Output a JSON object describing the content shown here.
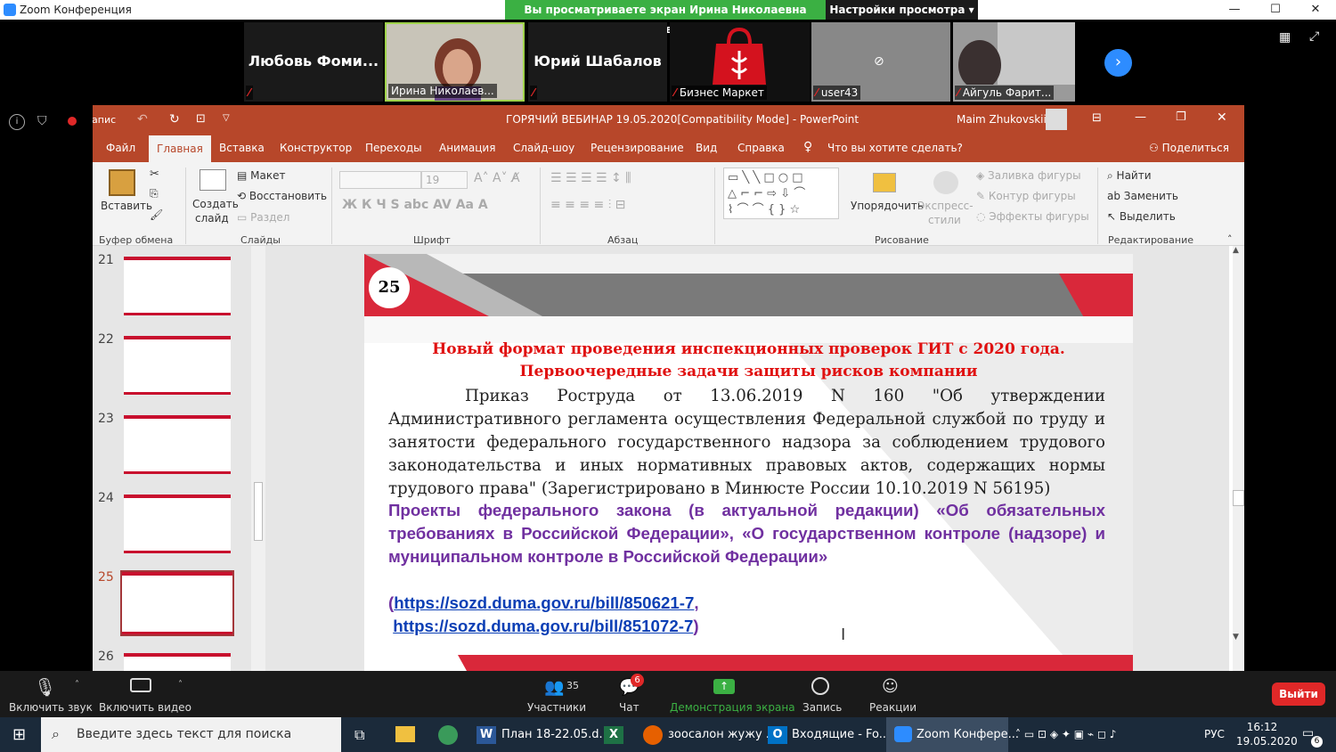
{
  "zoom": {
    "title": "Zoom Конференция",
    "banner": "Вы просматриваете экран Ирина Николаевна Жуковская",
    "view_settings": "Настройки просмотра ▾",
    "participants": [
      {
        "name": "Любовь Фоми...",
        "label": ""
      },
      {
        "name": "",
        "label": "Ирина Николаев..."
      },
      {
        "name": "Юрий Шабалов",
        "label": ""
      },
      {
        "name": "",
        "label": "Бизнес Маркет"
      },
      {
        "name": "",
        "label": "user43"
      },
      {
        "name": "",
        "label": "Айгуль Фарит..."
      }
    ],
    "recording_label": "Запис",
    "toolbar": {
      "mute": "Включить звук",
      "video": "Включить видео",
      "participants": "Участники",
      "participants_count": "35",
      "chat": "Чат",
      "chat_badge": "6",
      "share": "Демонстрация экрана",
      "record": "Запись",
      "reactions": "Реакции",
      "leave": "Выйти"
    }
  },
  "ppt": {
    "title": "ГОРЯЧИЙ ВЕБИНАР 19.05.2020[Compatibility Mode]  -  PowerPoint",
    "user": "Maim Zhukovskii",
    "tabs": [
      "Файл",
      "Главная",
      "Вставка",
      "Конструктор",
      "Переходы",
      "Анимация",
      "Слайд-шоу",
      "Рецензирование",
      "Вид",
      "Справка"
    ],
    "tell_me": "Что вы хотите сделать?",
    "share": "Поделиться",
    "ribbon": {
      "paste": "Вставить",
      "clipboard": "Буфер обмена",
      "new_slide": "Создать",
      "new_slide2": "слайд",
      "layout": "Макет",
      "reset": "Восстановить",
      "section": "Раздел",
      "slides": "Слайды",
      "font_size": "19",
      "font": "Шрифт",
      "paragraph": "Абзац",
      "arrange": "Упорядочить",
      "quick_styles": "Экспресс-",
      "quick_styles2": "стили",
      "shape_fill": "Заливка фигуры",
      "shape_outline": "Контур фигуры",
      "shape_effects": "Эффекты фигуры",
      "drawing": "Рисование",
      "find": "Найти",
      "replace": "Заменить",
      "select": "Выделить",
      "editing": "Редактирование"
    },
    "thumbs": [
      "21",
      "22",
      "23",
      "24",
      "25",
      "26"
    ],
    "slide": {
      "number": "25",
      "heading1": "Новый формат проведения инспекционных проверок ГИТ с 2020 года.",
      "heading2": "Первоочередные задачи защиты рисков компании",
      "body": "Приказ Роструда от 13.06.2019 N 160 \"Об утверждении Административного регламента осуществления Федеральной службой по труду и занятости федерального государственного надзора за соблюдением трудового законодательства и иных нормативных правовых актов, содержащих нормы трудового права\" (Зарегистрировано в Минюсте России 10.10.2019 N 56195)",
      "projects": "Проекты федерального закона (в актуальной редакции) «Об обязательных требованиях в Российской Федерации», «О государственном контроле (надзоре) и муниципальном контроле в Российской Федерации»",
      "link1": "https://sozd.duma.gov.ru/bill/850621-7",
      "link2": "https://sozd.duma.gov.ru/bill/851072-7"
    }
  },
  "taskbar": {
    "search": "Введите здесь текст для поиска",
    "apps": [
      "План 18-22.05.d...",
      "зоосалон жужу ...",
      "Входящие - Fo...",
      "Zoom Конфере..."
    ],
    "lang": "РУС",
    "time": "16:12",
    "date": "19.05.2020",
    "notif": "6"
  },
  "colors": {
    "ppt": "#b7472a",
    "zoom_green": "#3bb043",
    "zoom_red": "#e02828",
    "heading": "#e01010",
    "purple": "#7030a0"
  }
}
